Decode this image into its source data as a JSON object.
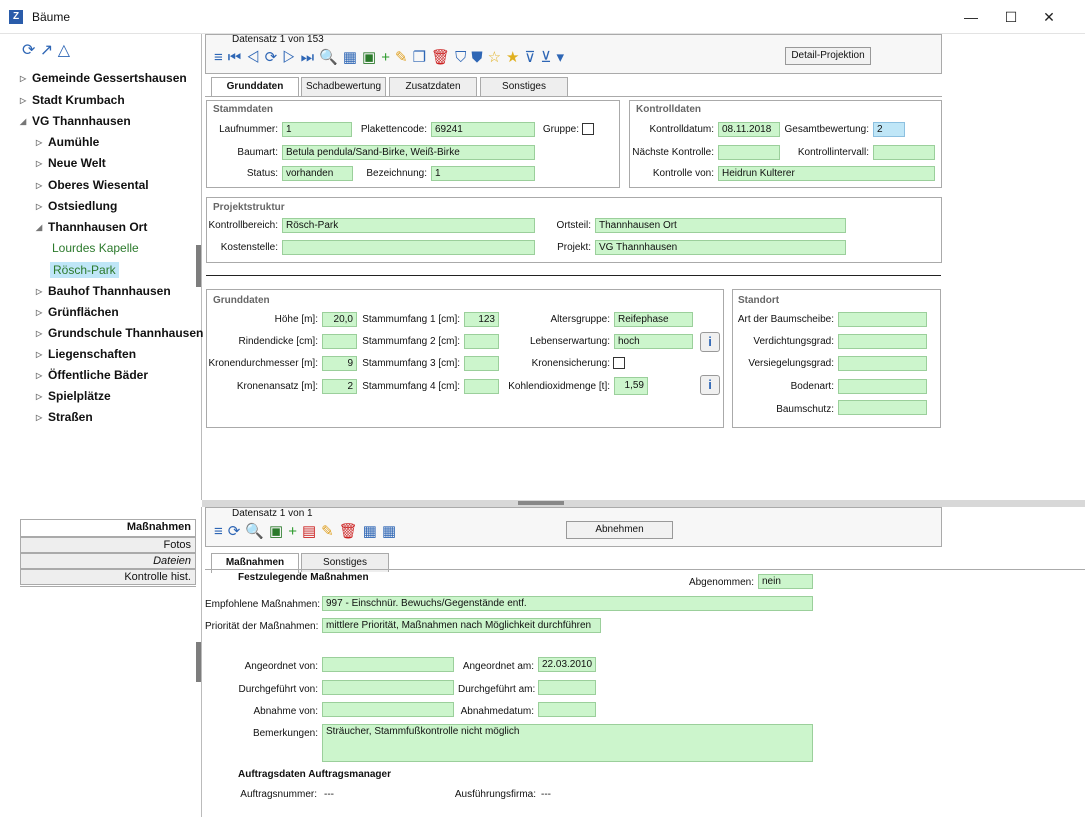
{
  "window": {
    "title": "Bäume",
    "app_icon": "Z",
    "min": "—",
    "max": "☐",
    "close": "✕"
  },
  "sidebar": {
    "items": [
      {
        "label": "Gemeinde Gessertshausen"
      },
      {
        "label": "Stadt Krumbach"
      },
      {
        "label": "VG Thannhausen"
      },
      {
        "label": "Aumühle"
      },
      {
        "label": "Neue Welt"
      },
      {
        "label": "Oberes Wiesental"
      },
      {
        "label": "Ostsiedlung"
      },
      {
        "label": "Thannhausen Ort"
      },
      {
        "label": "Lourdes Kapelle"
      },
      {
        "label": "Rösch-Park"
      },
      {
        "label": "Bauhof Thannhausen"
      },
      {
        "label": "Grünflächen"
      },
      {
        "label": "Grundschule Thannhausen"
      },
      {
        "label": "Liegenschaften"
      },
      {
        "label": "Öffentliche Bäder"
      },
      {
        "label": "Spielplätze"
      },
      {
        "label": "Straßen"
      }
    ]
  },
  "top": {
    "record_label": "Datensatz 1 von 153",
    "detail_button": "Detail-Projektion",
    "tabs": [
      {
        "label": "Grunddaten"
      },
      {
        "label": "Schadbewertung"
      },
      {
        "label": "Zusatzdaten"
      },
      {
        "label": "Sonstiges"
      }
    ],
    "stammdaten": {
      "title": "Stammdaten",
      "laufnummer_label": "Laufnummer:",
      "laufnummer": "1",
      "plakettencode_label": "Plakettencode:",
      "plakettencode": "69241",
      "gruppe_label": "Gruppe:",
      "baumart_label": "Baumart:",
      "baumart": "Betula pendula/Sand-Birke, Weiß-Birke",
      "status_label": "Status:",
      "status": "vorhanden",
      "bezeichnung_label": "Bezeichnung:",
      "bezeichnung": "1"
    },
    "kontrolldaten": {
      "title": "Kontrolldaten",
      "kontrolldatum_label": "Kontrolldatum:",
      "kontrolldatum": "08.11.2018",
      "gesamt_label": "Gesamtbewertung:",
      "gesamt": "2",
      "naechste_label": "Nächste Kontrolle:",
      "intervall_label": "Kontrollintervall:",
      "von_label": "Kontrolle von:",
      "von": "Heidrun Kulterer"
    },
    "projekt": {
      "title": "Projektstruktur",
      "bereich_label": "Kontrollbereich:",
      "bereich": "Rösch-Park",
      "ortsteil_label": "Ortsteil:",
      "ortsteil": "Thannhausen Ort",
      "kostenstelle_label": "Kostenstelle:",
      "projekt_label": "Projekt:",
      "projekt": "VG Thannhausen"
    },
    "grunddaten": {
      "title": "Grunddaten",
      "hoehe_label": "Höhe [m]:",
      "hoehe": "20,0",
      "rinde_label": "Rindendicke [cm]:",
      "krone_d_label": "Kronendurchmesser [m]:",
      "krone_d": "9",
      "krone_a_label": "Kronenansatz [m]:",
      "krone_a": "2",
      "su1_label": "Stammumfang 1 [cm]:",
      "su1": "123",
      "su2_label": "Stammumfang 2 [cm]:",
      "su3_label": "Stammumfang 3 [cm]:",
      "su4_label": "Stammumfang 4 [cm]:",
      "alter_label": "Altersgruppe:",
      "alter": "Reifephase",
      "leben_label": "Lebenserwartung:",
      "leben": "hoch",
      "kronensich_label": "Kronensicherung:",
      "co2_label": "Kohlendioxidmenge [t]:",
      "co2": "1,59"
    },
    "standort": {
      "title": "Standort",
      "scheibe_label": "Art der Baumscheibe:",
      "verdicht_label": "Verdichtungsgrad:",
      "versiegel_label": "Versiegelungsgrad:",
      "boden_label": "Bodenart:",
      "schutz_label": "Baumschutz:"
    }
  },
  "lower_sidebar": {
    "tabs": [
      {
        "label": "Maßnahmen"
      },
      {
        "label": "Fotos"
      },
      {
        "label": "Dateien"
      },
      {
        "label": "Kontrolle hist."
      }
    ]
  },
  "bottom": {
    "record_label": "Datensatz 1 von 1",
    "abnehmen_button": "Abnehmen",
    "tabs": [
      {
        "label": "Maßnahmen"
      },
      {
        "label": "Sonstiges"
      }
    ],
    "festzulegende": "Festzulegende Maßnahmen",
    "abgenommen_label": "Abgenommen:",
    "abgenommen": "nein",
    "empfohlen_label": "Empfohlene Maßnahmen:",
    "empfohlen": "997 - Einschnür. Bewuchs/Gegenstände entf.",
    "prioritaet_label": "Priorität der Maßnahmen:",
    "prioritaet": "mittlere Priorität, Maßnahmen nach Möglichkeit durchführen",
    "angeordnet_von_label": "Angeordnet von:",
    "angeordnet_am_label": "Angeordnet am:",
    "angeordnet_am": "22.03.2010",
    "durchgefuehrt_von_label": "Durchgeführt von:",
    "durchgefuehrt_am_label": "Durchgeführt am:",
    "abnahme_von_label": "Abnahme von:",
    "abnahmedatum_label": "Abnahmedatum:",
    "bemerkungen_label": "Bemerkungen:",
    "bemerkungen": "Sträucher, Stammfußkontrolle nicht möglich",
    "auftrag_title": "Auftragsdaten Auftragsmanager",
    "auftragsnummer_label": "Auftragsnummer:",
    "auftragsnummer": "---",
    "firma_label": "Ausführungsfirma:",
    "firma": "---"
  }
}
